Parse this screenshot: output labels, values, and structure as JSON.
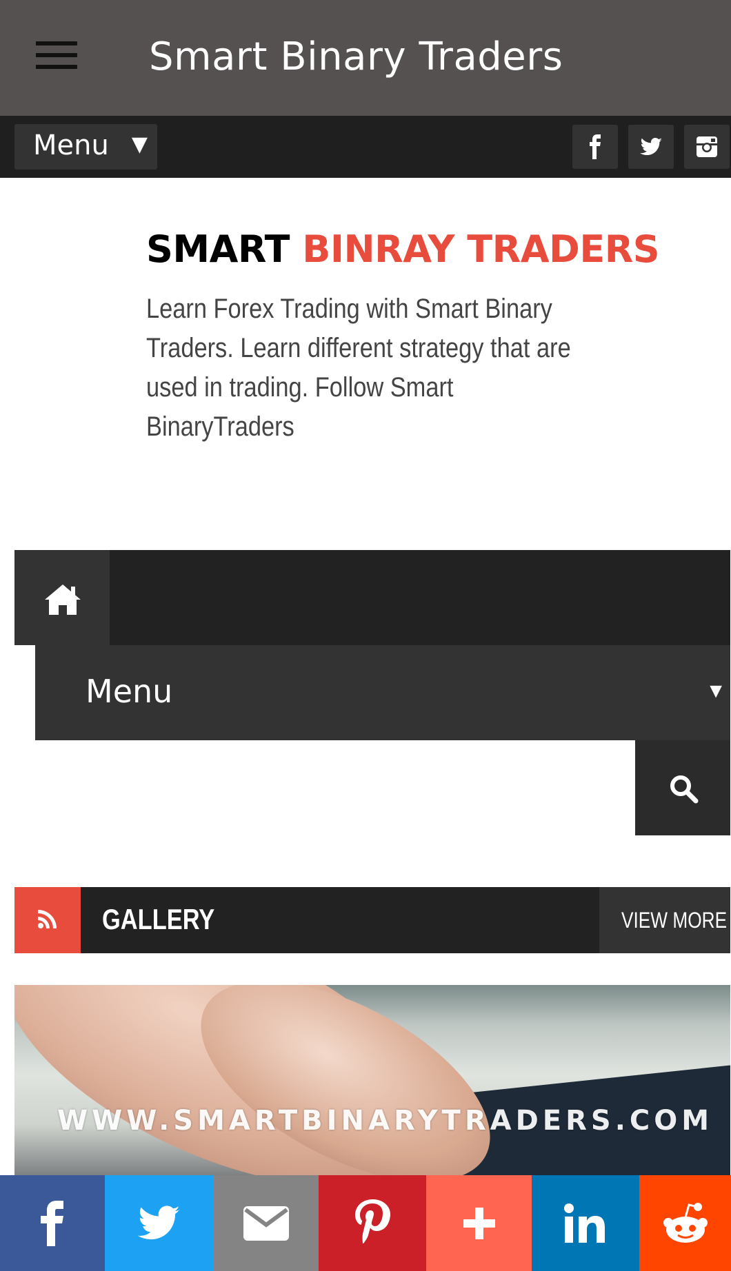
{
  "app_bar": {
    "title": "Smart Binary Traders",
    "menu_icon": "hamburger-icon"
  },
  "top_bar": {
    "menu_label": "Menu",
    "menu_arrow": "▼",
    "social": [
      "facebook-icon",
      "twitter-icon",
      "instagram-icon"
    ]
  },
  "header": {
    "brand_word1": "SMART",
    "brand_word2": "BINRAY TRADERS",
    "tagline": "Learn Forex Trading with Smart Binary Traders. Learn different strategy that are used in trading. Follow Smart BinaryTraders"
  },
  "nav": {
    "home_icon": "home-icon",
    "menu_label": "Menu",
    "menu_arrow": "▼",
    "search_icon": "search-icon"
  },
  "gallery": {
    "title": "GALLERY",
    "view_more": "VIEW MORE",
    "image_watermark": "WWW.SMARTBINARYTRADERS.COM"
  },
  "share_bar": {
    "buttons": [
      {
        "icon": "facebook-icon",
        "color": "#3b5998"
      },
      {
        "icon": "twitter-icon",
        "color": "#1da1f2"
      },
      {
        "icon": "email-icon",
        "color": "#848484"
      },
      {
        "icon": "pinterest-icon",
        "color": "#cb2027"
      },
      {
        "icon": "plus-icon",
        "color": "#ff6550"
      },
      {
        "icon": "linkedin-icon",
        "color": "#0077b5"
      },
      {
        "icon": "reddit-icon",
        "color": "#ff4500"
      }
    ]
  },
  "colors": {
    "accent_red": "#e74c3c",
    "app_bar": "#545150",
    "dark_bar": "#222222"
  }
}
